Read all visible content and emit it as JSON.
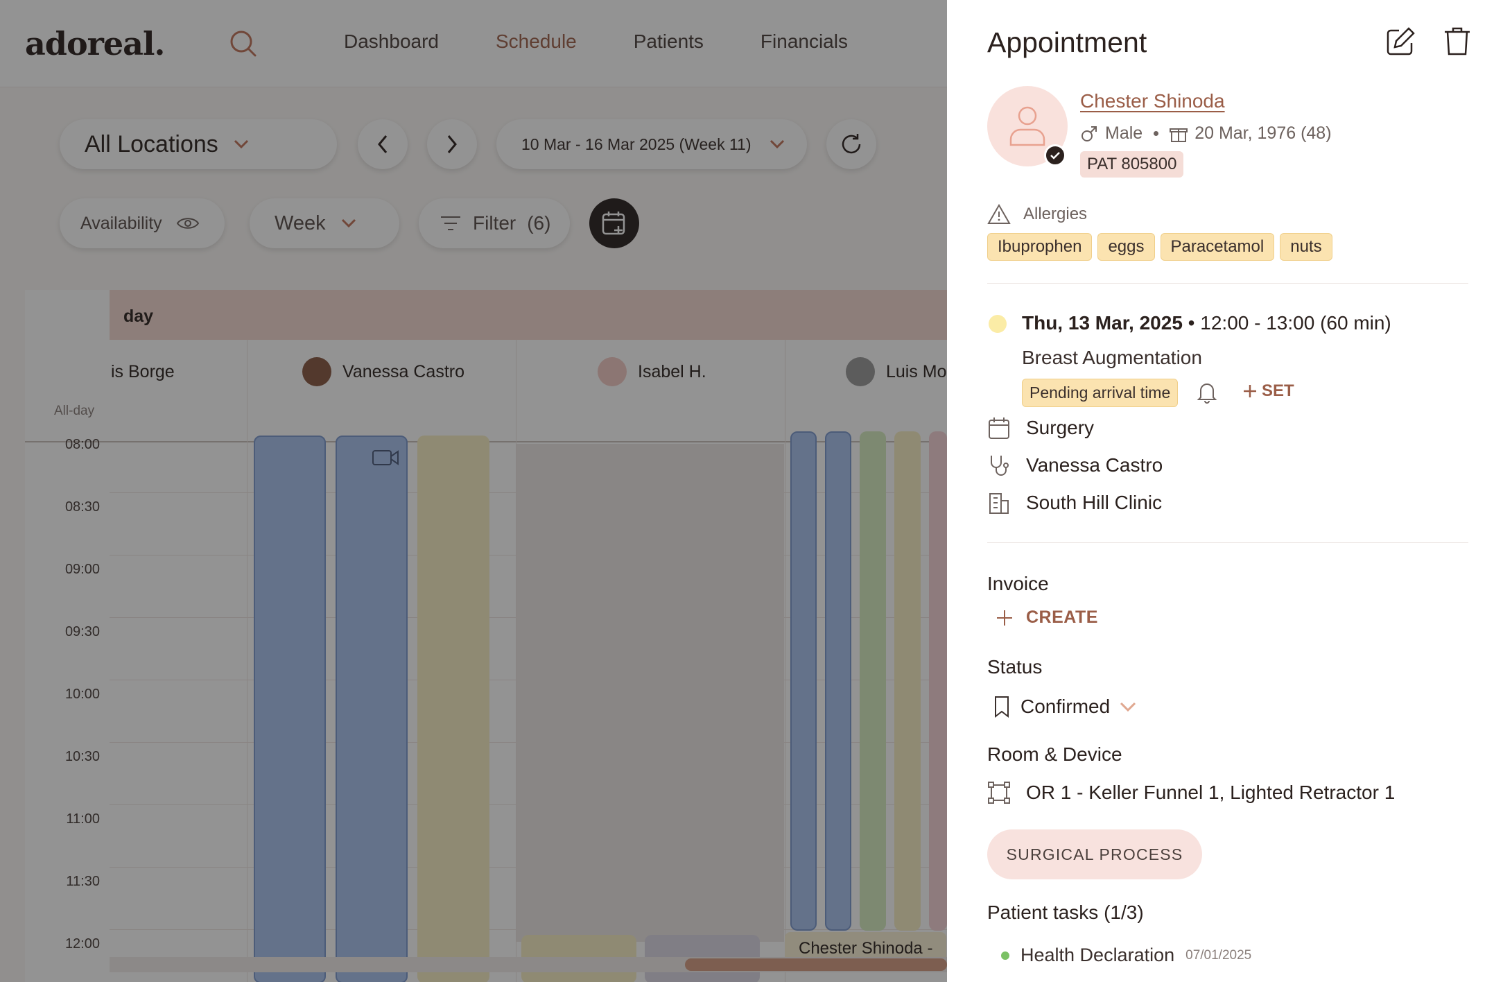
{
  "app": {
    "logo": "adoreal.",
    "nav": [
      "Dashboard",
      "Schedule",
      "Patients",
      "Financials"
    ]
  },
  "toolbar": {
    "location": "All Locations",
    "date_range": "10 Mar - 16 Mar 2025 (Week 11)",
    "availability": "Availability",
    "view": "Week",
    "filter": "Filter",
    "filter_count": "(6)"
  },
  "calendar": {
    "day_header": "day",
    "staff": [
      "is Borge",
      "Vanessa Castro",
      "Isabel H.",
      "Luis Mo"
    ],
    "allday_label": "All-day",
    "times": [
      "08:00",
      "08:30",
      "09:00",
      "09:30",
      "10:00",
      "10:30",
      "11:00",
      "11:30",
      "12:00"
    ],
    "event_label": "Chester Shinoda -"
  },
  "panel": {
    "title": "Appointment",
    "patient": {
      "name": "Chester Shinoda",
      "gender": "Male",
      "dob": "20 Mar, 1976 (48)",
      "id": "PAT 805800"
    },
    "allergies_label": "Allergies",
    "allergies": [
      "Ibuprophen",
      "eggs",
      "Paracetamol",
      "nuts"
    ],
    "appointment": {
      "date": "Thu, 13 Mar, 2025",
      "time": "12:00 - 13:00 (60 min)",
      "procedure": "Breast Augmentation",
      "arrival": "Pending arrival time",
      "set_label": "SET",
      "type": "Surgery",
      "provider": "Vanessa Castro",
      "location": "South Hill Clinic"
    },
    "invoice_label": "Invoice",
    "create_label": "CREATE",
    "status_label": "Status",
    "status_value": "Confirmed",
    "room_label": "Room & Device",
    "room_value": "OR 1 - Keller Funnel 1, Lighted Retractor 1",
    "surgical_button": "SURGICAL PROCESS",
    "tasks_label": "Patient tasks (1/3)",
    "task": {
      "name": "Health Declaration",
      "date": "07/01/2025"
    }
  },
  "colors": {
    "accent": "#9a5d47",
    "dark": "#2b211e",
    "tag_bg": "#fbe3b0",
    "event_blue": "#a9c3ee"
  }
}
